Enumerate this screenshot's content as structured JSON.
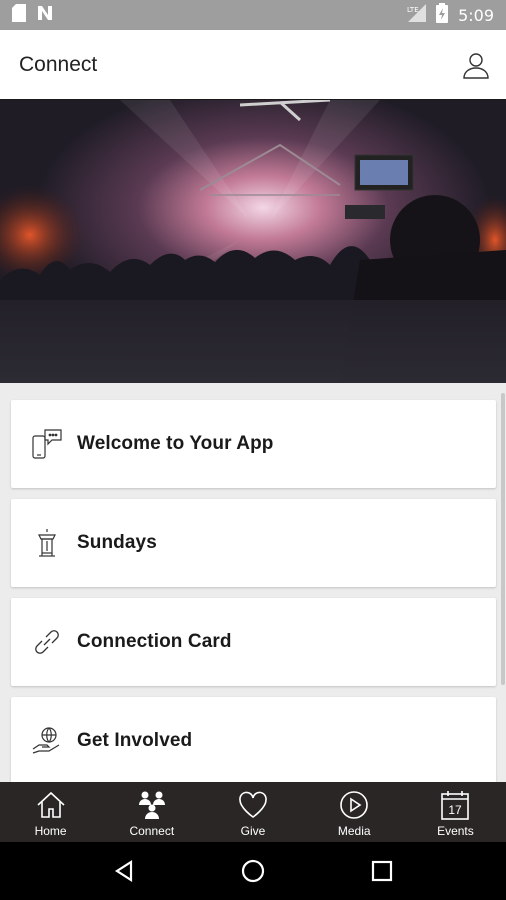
{
  "status_bar": {
    "time": "5:09",
    "network_label": "LTE",
    "icons": [
      "sd-card-icon",
      "notification-n-icon",
      "signal-icon",
      "battery-icon"
    ]
  },
  "header": {
    "title": "Connect",
    "profile_icon": "person-icon"
  },
  "hero": {
    "description_icon": "concert-crowd-photo"
  },
  "cards": [
    {
      "label": "Welcome to Your App",
      "icon": "phone-chat-icon"
    },
    {
      "label": "Sundays",
      "icon": "pulpit-icon"
    },
    {
      "label": "Connection Card",
      "icon": "link-icon"
    },
    {
      "label": "Get Involved",
      "icon": "hand-globe-icon"
    }
  ],
  "bottom_nav": [
    {
      "label": "Home",
      "icon": "home-icon"
    },
    {
      "label": "Connect",
      "icon": "people-icon",
      "active": true
    },
    {
      "label": "Give",
      "icon": "heart-icon"
    },
    {
      "label": "Media",
      "icon": "play-icon"
    },
    {
      "label": "Events",
      "icon": "calendar-icon",
      "calendar_day": "17"
    }
  ],
  "colors": {
    "status_bar": "#9e9e9e",
    "header_bg": "#ffffff",
    "nav_bg": "#2a2626",
    "system_nav_bg": "#000000",
    "content_bg": "#ececec"
  }
}
